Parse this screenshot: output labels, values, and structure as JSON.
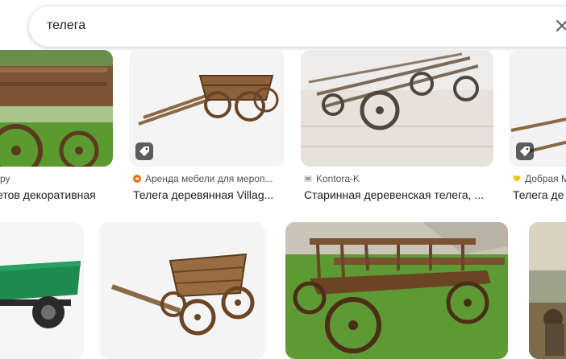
{
  "search": {
    "query": "телега"
  },
  "row1": [
    {
      "source": "ру",
      "title": "етов декоративная"
    },
    {
      "source": "Аренда мебели для мероп...",
      "title": "Телега деревянная Villag..."
    },
    {
      "source": "Kontora-K",
      "title": "Старинная деревенская телега, ..."
    },
    {
      "source": "Добрая М",
      "title": "Телега де"
    }
  ],
  "colors": {
    "accent_orange": "#e8710a",
    "heart_yellow": "#f2c500",
    "grass": "#5a9a2e",
    "wood": "#8a5a34",
    "cart_green": "#1f8a50"
  }
}
